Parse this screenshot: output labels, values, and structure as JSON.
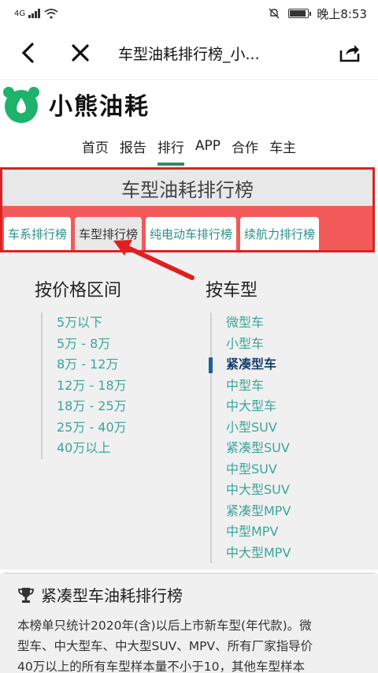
{
  "status_bar": {
    "network": "4G",
    "time": "晚上8:53"
  },
  "nav_bar": {
    "title": "车型油耗排行榜_小...",
    "icons": [
      "back-arrow-icon",
      "close-icon",
      "share-icon"
    ]
  },
  "site": {
    "brand": "小熊油耗",
    "brand_color": "#1db36b"
  },
  "top_nav": {
    "items": [
      {
        "label": "首页"
      },
      {
        "label": "报告"
      },
      {
        "label": "排行"
      },
      {
        "label": "APP"
      },
      {
        "label": "合作"
      },
      {
        "label": "车主"
      }
    ],
    "active_index": 2,
    "accent": "#2e8b6e"
  },
  "ranking": {
    "title": "车型油耗排行榜",
    "tabs": [
      {
        "label": "车系排行榜"
      },
      {
        "label": "车型排行榜"
      },
      {
        "label": "纯电动车排行榜"
      },
      {
        "label": "续航力排行榜"
      }
    ],
    "active_tab": 1
  },
  "filters": {
    "price": {
      "title": "按价格区间",
      "items": [
        "5万以下",
        "5万 - 8万",
        "8万 - 12万",
        "12万 - 18万",
        "18万 - 25万",
        "25万 - 40万",
        "40万以上"
      ]
    },
    "type": {
      "title": "按车型",
      "items": [
        "微型车",
        "小型车",
        "紧凑型车",
        "中型车",
        "中大型车",
        "小型SUV",
        "紧凑型SUV",
        "中型SUV",
        "中大型SUV",
        "紧凑型MPV",
        "中型MPV",
        "中大型MPV"
      ],
      "active_index": 2
    }
  },
  "section": {
    "title": "紧凑型车油耗排行榜",
    "lines": [
      "本榜单只统计2020年(含)以后上市新车型(年代款)。微",
      "型车、中大型车、中大型SUV、MPV、所有厂家指导价",
      "40万以上的所有车型样本量不小于10，其他车型样本"
    ]
  }
}
